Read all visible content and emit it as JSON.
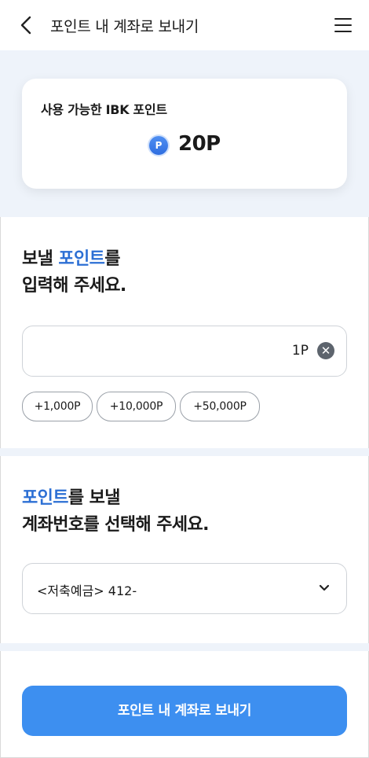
{
  "header": {
    "title": "포인트 내 계좌로 보내기"
  },
  "points_card": {
    "label": "사용 가능한 IBK 포인트",
    "coin_symbol": "P",
    "amount": "20P"
  },
  "amount_section": {
    "heading_line1_normal": "보낼 ",
    "heading_line1_highlight": "포인트",
    "heading_line1_end": "를",
    "heading_line2": "입력해 주세요.",
    "input_value": "1P",
    "clear_symbol": "✕",
    "chips": [
      "+1,000P",
      "+10,000P",
      "+50,000P"
    ]
  },
  "account_section": {
    "heading_line1_highlight": "포인트",
    "heading_line1_end": "를 보낼",
    "heading_line2": "계좌번호를 선택해 주세요.",
    "selected_account": "<저축예금> 412-"
  },
  "submit": {
    "label": "포인트 내 계좌로 보내기"
  },
  "colors": {
    "accent": "#2c6fd4",
    "button": "#3d8ff0",
    "band": "#eef3fa"
  },
  "icons": [
    "back-arrow-icon",
    "hamburger-menu-icon",
    "point-coin-icon",
    "clear-icon",
    "chevron-down-icon"
  ]
}
